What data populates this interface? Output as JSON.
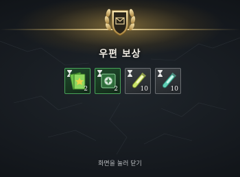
{
  "popup": {
    "title": "우편 보상",
    "close_hint": "화면을 눌러 닫기"
  },
  "rewards": [
    {
      "icon": "green-ticket-icon",
      "count": "2",
      "rarity": "green"
    },
    {
      "icon": "green-box-icon",
      "count": "2",
      "rarity": "green"
    },
    {
      "icon": "yellow-potion-icon",
      "count": "10",
      "rarity": "gray"
    },
    {
      "icon": "teal-potion-icon",
      "count": "10",
      "rarity": "gray"
    }
  ],
  "colors": {
    "gold_glow": "#e6c878",
    "green_frame": "#49a45a",
    "gray_frame": "#6b6f73"
  }
}
